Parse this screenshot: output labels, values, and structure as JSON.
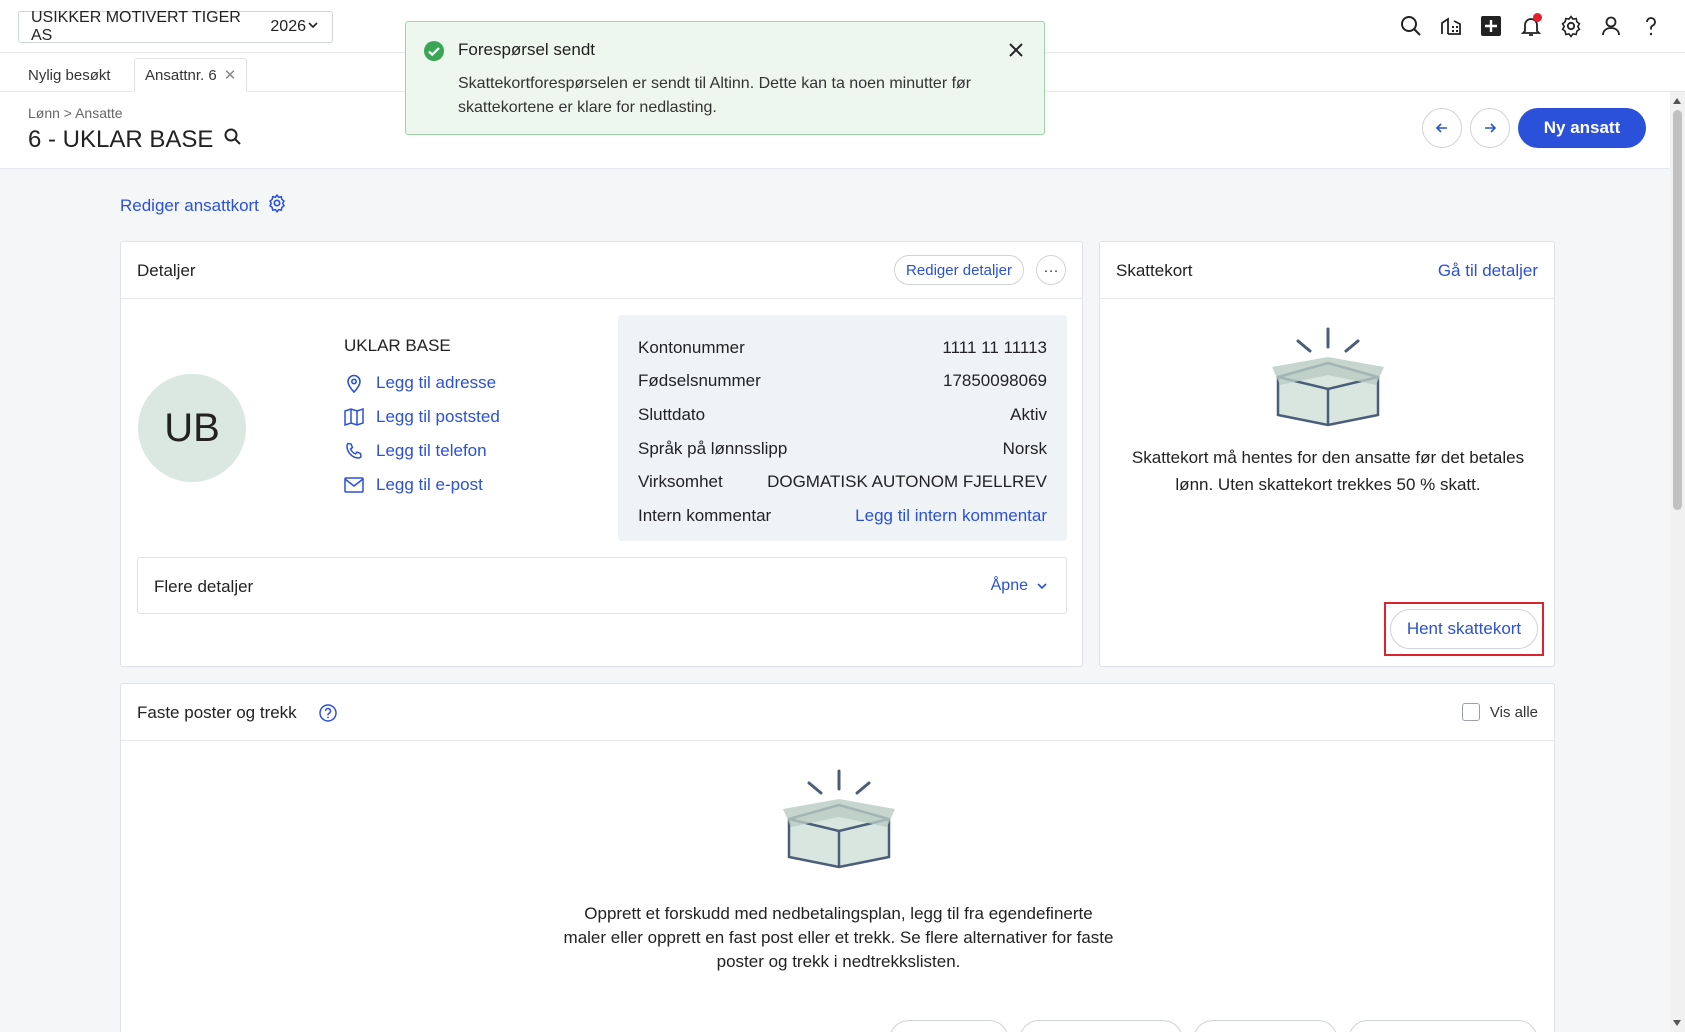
{
  "topbar": {
    "company": "USIKKER MOTIVERT TIGER AS",
    "year": "2026"
  },
  "tabs": {
    "recent": "Nylig besøkt",
    "active": "Ansattnr. 6"
  },
  "header": {
    "breadcrumb": "Lønn > Ansatte",
    "title": "6 - UKLAR BASE",
    "new_button": "Ny ansatt"
  },
  "toast": {
    "title": "Forespørsel sendt",
    "message": "Skattekortforespørselen er sendt til Altinn. Dette kan ta noen minutter før skattekortene er klare for nedlasting."
  },
  "edit_card_link": "Rediger ansattkort",
  "details": {
    "title": "Detaljer",
    "edit_button": "Rediger detaljer",
    "more_button": "···",
    "avatar_initials": "UB",
    "name": "UKLAR BASE",
    "links": [
      {
        "label": "Legg til adresse",
        "icon": "location-pin-icon"
      },
      {
        "label": "Legg til poststed",
        "icon": "map-icon"
      },
      {
        "label": "Legg til telefon",
        "icon": "phone-icon"
      },
      {
        "label": "Legg til e-post",
        "icon": "mail-icon"
      }
    ],
    "info": [
      {
        "label": "Kontonummer",
        "value": "1111 11 11113"
      },
      {
        "label": "Fødselsnummer",
        "value": "17850098069"
      },
      {
        "label": "Sluttdato",
        "value": "Aktiv"
      },
      {
        "label": "Språk på lønnsslipp",
        "value": "Norsk"
      },
      {
        "label": "Virksomhet",
        "value": "DOGMATISK AUTONOM FJELLREV"
      },
      {
        "label": "Intern kommentar",
        "value": "Legg til intern kommentar"
      }
    ],
    "more_details": "Flere detaljer",
    "open_label": "Åpne"
  },
  "skattekort": {
    "title": "Skattekort",
    "link": "Gå til detaljer",
    "text": "Skattekort må hentes for den ansatte før det betales lønn. Uten skattekort trekkes 50 % skatt.",
    "button": "Hent skattekort"
  },
  "faste": {
    "title": "Faste poster og trekk",
    "show_all": "Vis alle",
    "text": "Opprett et forskudd med nedbetalingsplan, legg til fra egendefinerte maler eller opprett en fast post eller et trekk. Se flere alternativer for faste poster og trekk i nedtrekkslisten."
  },
  "colors": {
    "primary": "#2b50d9",
    "success_bg": "#edf7ee",
    "success": "#3aa655",
    "highlight": "#d9232d"
  }
}
